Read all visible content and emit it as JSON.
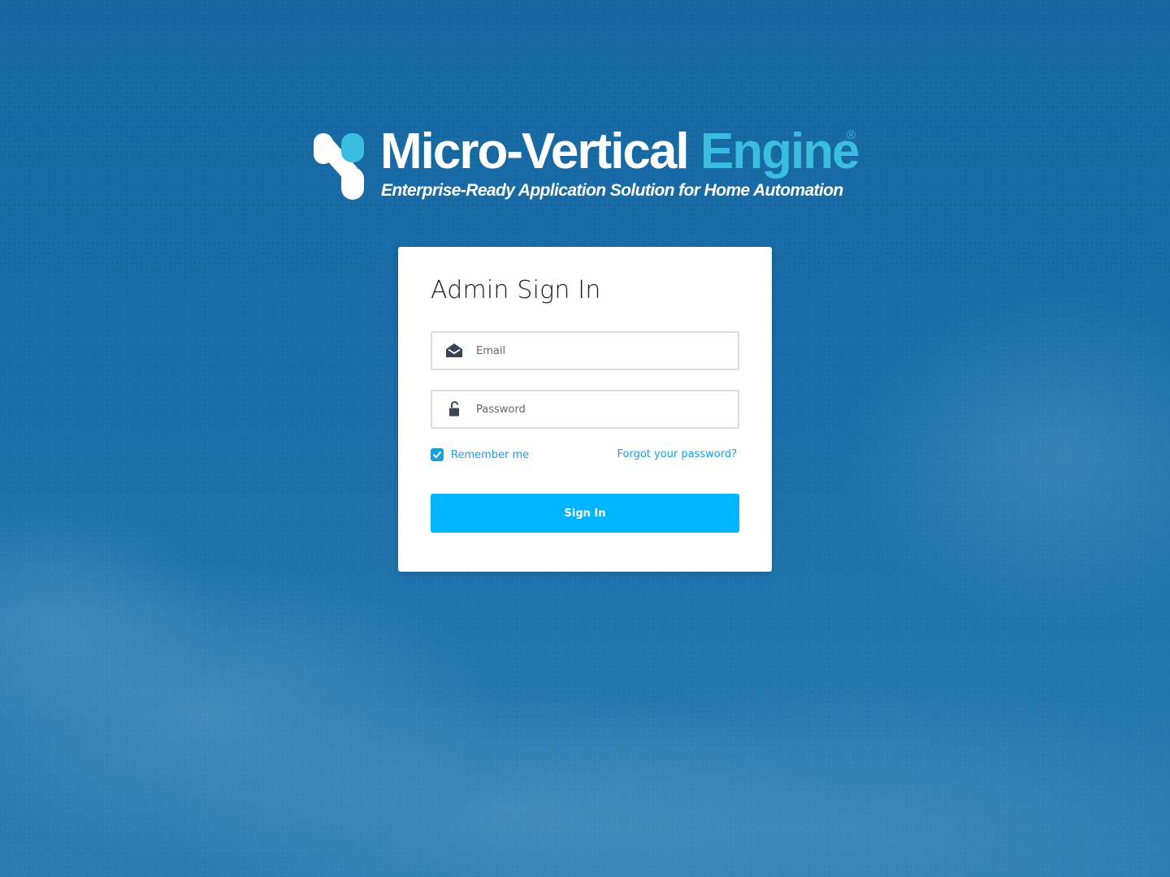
{
  "brand": {
    "title_part1": "Micro-Vertical",
    "title_part2": "Engine",
    "registered_mark": "®",
    "tagline": "Enterprise-Ready Application Solution for Home Automation",
    "colors": {
      "title": "#ffffff",
      "accent": "#3bbde0"
    }
  },
  "login": {
    "title": "Admin Sign In",
    "email": {
      "placeholder": "Email",
      "value": "",
      "icon": "envelope-open-icon"
    },
    "password": {
      "placeholder": "Password",
      "value": "",
      "icon": "unlock-icon"
    },
    "remember_me": {
      "label": "Remember me",
      "checked": true
    },
    "forgot_password_label": "Forgot your password?",
    "submit_label": "Sign In"
  },
  "colors": {
    "background": "#1b6fa8",
    "primary_button": "#00b4ff",
    "link": "#1a9ee0"
  }
}
